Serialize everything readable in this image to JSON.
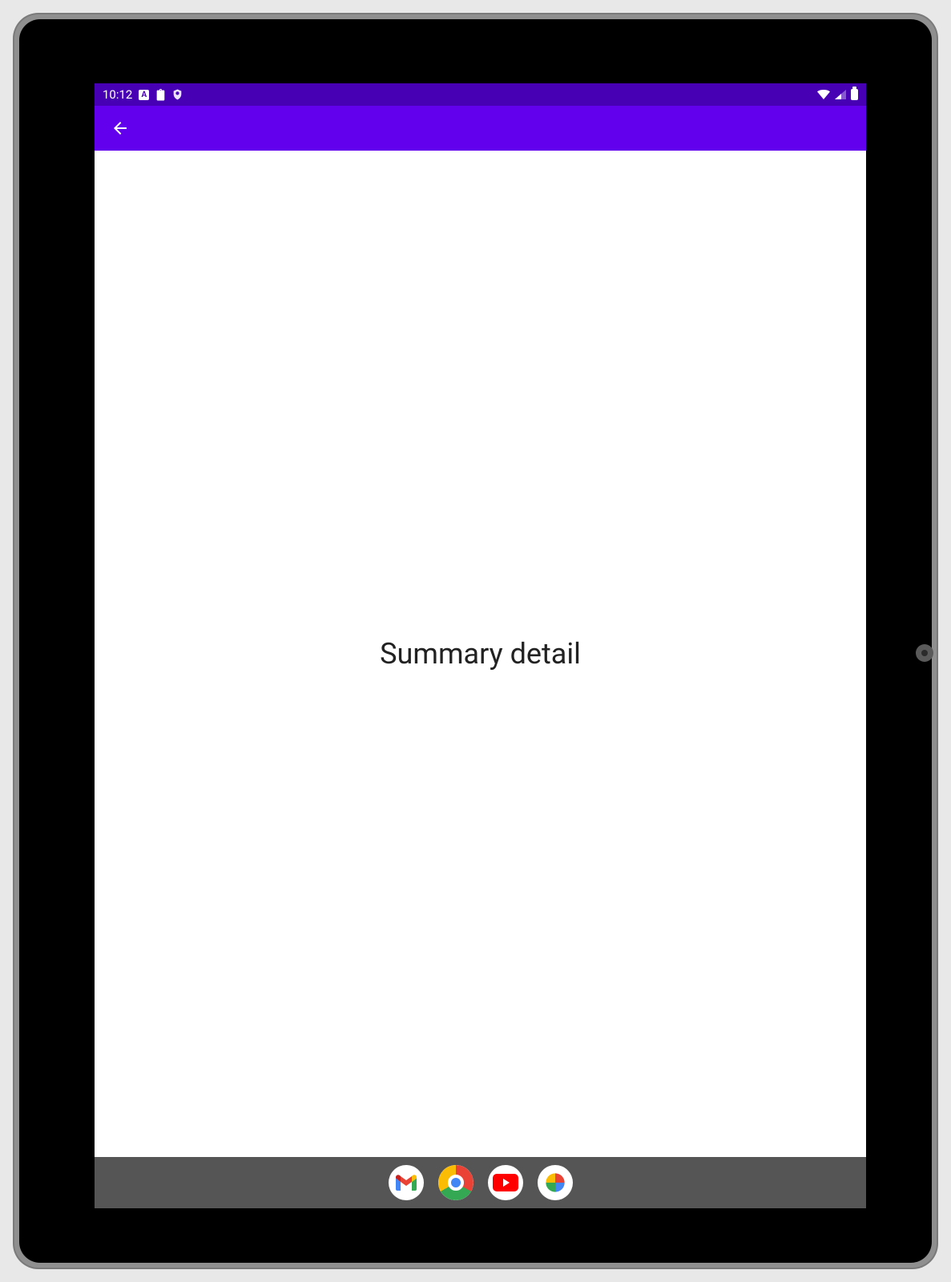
{
  "statusbar": {
    "time": "10:12",
    "icons_left": [
      "keyboard-a-icon",
      "clipboard-icon",
      "shield-icon"
    ],
    "icons_right": [
      "wifi-icon",
      "signal-icon",
      "battery-icon"
    ]
  },
  "appbar": {
    "back_icon": "arrow-back-icon"
  },
  "content": {
    "title": "Summary detail"
  },
  "navbar": {
    "apps": [
      {
        "name": "gmail-app-icon",
        "label": "Gmail"
      },
      {
        "name": "chrome-app-icon",
        "label": "Chrome"
      },
      {
        "name": "youtube-app-icon",
        "label": "YouTube"
      },
      {
        "name": "photos-app-icon",
        "label": "Photos"
      }
    ]
  },
  "colors": {
    "status_bg": "#4800b5",
    "appbar_bg": "#6200ee",
    "navbar_bg": "#555555"
  }
}
